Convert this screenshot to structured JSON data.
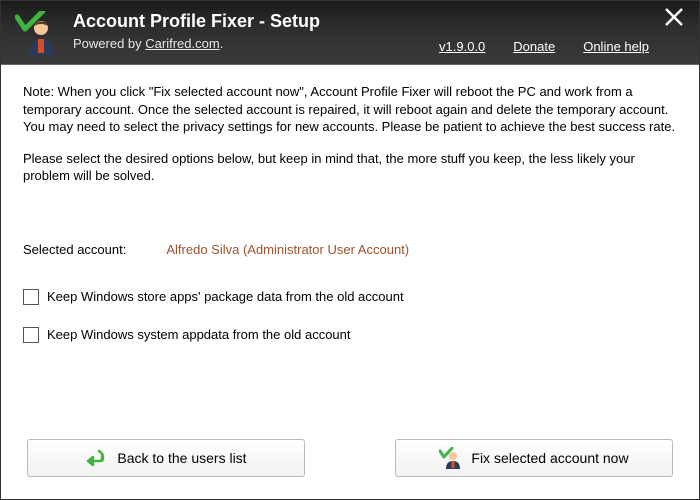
{
  "header": {
    "title": "Account Profile Fixer - Setup",
    "powered_prefix": "Powered by ",
    "powered_link": "Carifred.com",
    "powered_suffix": ".",
    "version": "v1.9.0.0",
    "donate": "Donate",
    "online_help": "Online help"
  },
  "note": {
    "para1": "Note: When you click \"Fix selected account now\", Account Profile Fixer will reboot the PC and work from a temporary account. Once the selected account is repaired, it will reboot again and delete the temporary account. You may need to select the privacy settings for new accounts. Please be patient to achieve the best success rate.",
    "para2": "Please select the desired options below, but keep in mind that, the more stuff you keep, the less likely your problem will be solved."
  },
  "selected": {
    "label": "Selected account:",
    "value": "Alfredo Silva (Administrator User Account)"
  },
  "options": {
    "keep_store": "Keep Windows store apps' package data from the old account",
    "keep_appdata": "Keep Windows system appdata from the old account"
  },
  "buttons": {
    "back": "Back to the users list",
    "fix": "Fix selected account now"
  }
}
